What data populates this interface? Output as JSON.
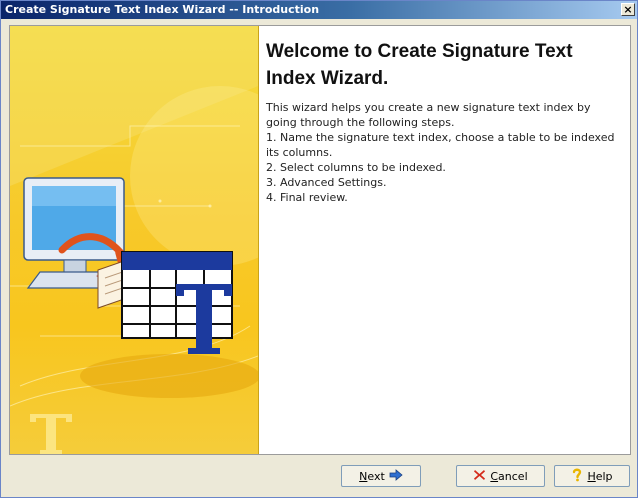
{
  "window": {
    "title": "Create Signature Text Index Wizard -- Introduction",
    "close_glyph": "×"
  },
  "side_panel": {
    "illustration": "monitor-book-table-illustration"
  },
  "content": {
    "title": "Welcome to Create Signature Text Index Wizard.",
    "intro": "This wizard helps you create a new signature text index by going through the following steps.",
    "steps": [
      "1. Name the signature text index, choose a table to be indexed its columns.",
      "2. Select columns to be indexed.",
      "3. Advanced Settings.",
      "4. Final review."
    ]
  },
  "buttons": {
    "next": {
      "mnemonic": "N",
      "rest": "ext",
      "icon": "arrow-right-icon"
    },
    "cancel": {
      "mnemonic": "C",
      "rest": "ancel",
      "icon": "red-x-icon"
    },
    "help": {
      "mnemonic": "H",
      "rest": "elp",
      "icon": "question-icon"
    }
  },
  "colors": {
    "titlebar_start": "#0a246a",
    "panel_yellow": "#f8c61e",
    "cancel_red": "#d42a1a",
    "next_blue": "#2f6fd0",
    "help_yellow": "#e9b600"
  }
}
